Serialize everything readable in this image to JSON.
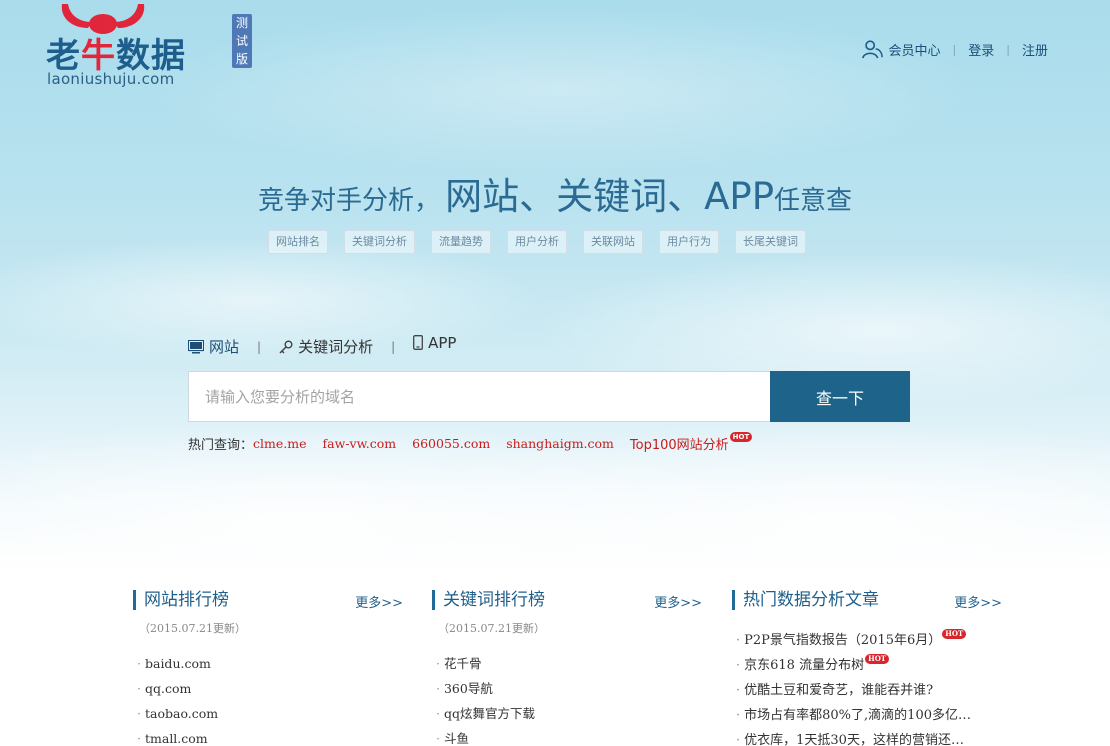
{
  "logo": {
    "name_part1": "老",
    "name_part2": "牛",
    "name_part3": "数据",
    "domain": "laoniushuju.com",
    "badge": "测试版"
  },
  "topnav": {
    "member_center": "会员中心",
    "login": "登录",
    "register": "注册",
    "separator": "|"
  },
  "headline": {
    "part1": "竞争对手分析，",
    "part2": "网站、关键词、APP",
    "part3": "任意查"
  },
  "tags": [
    "网站排名",
    "关键词分析",
    "流量趋势",
    "用户分析",
    "关联网站",
    "用户行为",
    "长尾关键词"
  ],
  "search": {
    "tabs": [
      {
        "label": "网站",
        "icon": "monitor-icon"
      },
      {
        "label": "关键词分析",
        "icon": "key-icon"
      },
      {
        "label": "APP",
        "icon": "mobile-phone-icon"
      }
    ],
    "tab_separator": "|",
    "placeholder": "请输入您要分析的域名",
    "button": "查一下"
  },
  "hot_query": {
    "label": "热门查询：",
    "links": [
      "clme.me",
      "faw-vw.com",
      "660055.com",
      "shanghaigm.com"
    ],
    "top100": "Top100网站分析",
    "hot_badge": "HOT"
  },
  "columns": {
    "sites": {
      "title": "网站排行榜",
      "more": "更多>>",
      "updated": "（2015.07.21更新）",
      "items": [
        "baidu.com",
        "qq.com",
        "taobao.com",
        "tmall.com"
      ]
    },
    "keywords": {
      "title": "关键词排行榜",
      "more": "更多>>",
      "updated": "（2015.07.21更新）",
      "items": [
        "花千骨",
        "360导航",
        "qq炫舞官方下载",
        "斗鱼"
      ]
    },
    "articles": {
      "title": "热门数据分析文章",
      "more": "更多>>",
      "items": [
        "P2P景气指数报告（2015年6月）",
        "京东618 流量分布树",
        "优酷土豆和爱奇艺，谁能吞并谁?",
        "市场占有率都80%了,滴滴的100多亿…",
        "优衣库，1天抵30天，这样的营销还…"
      ],
      "hot_badge": "HOT"
    }
  },
  "colors": {
    "brand_blue": "#1e6389",
    "logo_red": "#e0263a",
    "link_red": "#c81c1c"
  }
}
